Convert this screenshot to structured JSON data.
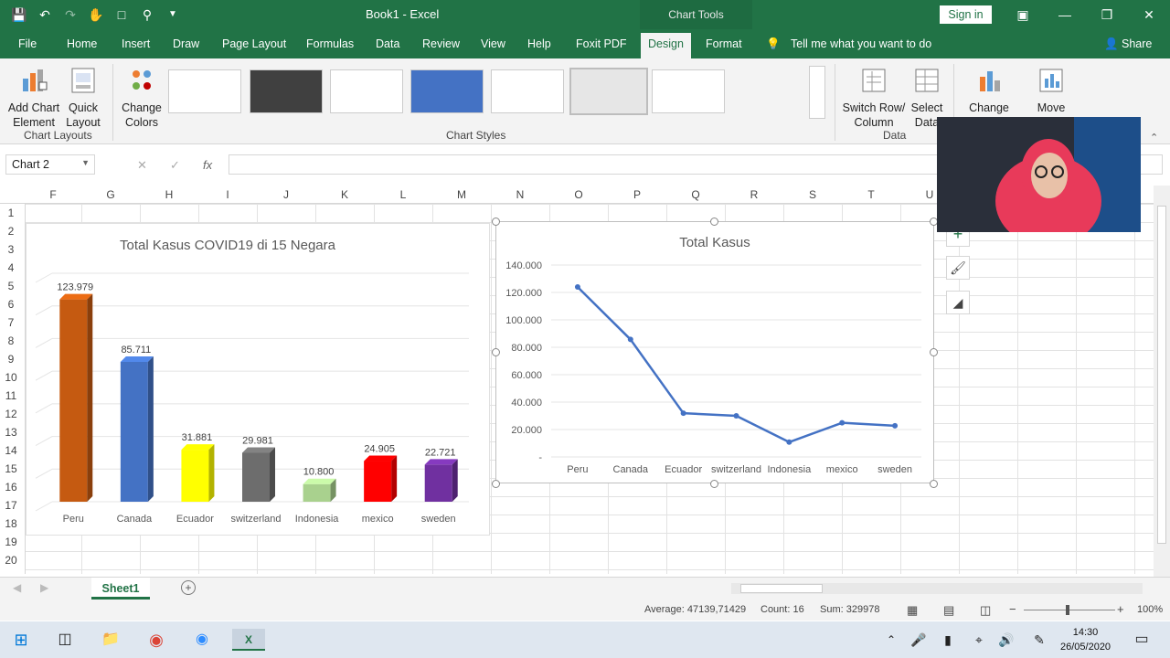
{
  "window": {
    "title": "Book1 - Excel",
    "context_tab": "Chart Tools",
    "signin": "Sign in"
  },
  "tabs": [
    "File",
    "Home",
    "Insert",
    "Draw",
    "Page Layout",
    "Formulas",
    "Data",
    "Review",
    "View",
    "Help",
    "Foxit PDF",
    "Design",
    "Format"
  ],
  "active_tab": "Design",
  "tell_me": "Tell me what you want to do",
  "share": "Share",
  "ribbon": {
    "add_chart_element": "Add Chart Element",
    "quick_layout": "Quick Layout",
    "change_colors": "Change Colors",
    "chart_layouts_label": "Chart Layouts",
    "chart_styles_label": "Chart Styles",
    "switch_row_column": "Switch Row/ Column",
    "select_data": "Select Data",
    "data_label": "Data",
    "change_chart_type": "Change Chart Type",
    "move_chart": "Move Chart"
  },
  "formula_bar": {
    "name_box": "Chart 2",
    "fx": "fx",
    "value": ""
  },
  "columns": [
    "F",
    "G",
    "H",
    "I",
    "J",
    "K",
    "L",
    "M",
    "N",
    "O",
    "P",
    "Q",
    "R",
    "S",
    "T",
    "U"
  ],
  "rows": [
    "1",
    "2",
    "3",
    "4",
    "5",
    "6",
    "7",
    "8",
    "9",
    "10",
    "11",
    "12",
    "13",
    "14",
    "15",
    "16",
    "17",
    "18",
    "19",
    "20"
  ],
  "chart_data": [
    {
      "type": "bar",
      "title": "Total Kasus COVID19 di 15 Negara",
      "categories": [
        "Peru",
        "Canada",
        "Ecuador",
        "switzerland",
        "Indonesia",
        "mexico",
        "sweden"
      ],
      "values": [
        123979,
        85711,
        31881,
        29981,
        10800,
        24905,
        22721
      ],
      "data_labels": [
        "123.979",
        "85.711",
        "31.881",
        "29.981",
        "10.800",
        "24.905",
        "22.721"
      ],
      "colors": [
        "#c55a11",
        "#4472c4",
        "#ffff00",
        "#6d6d6d",
        "#a9d18e",
        "#ff0000",
        "#7030a0"
      ],
      "ylim": [
        0,
        140000
      ],
      "grid": true
    },
    {
      "type": "line",
      "title": "Total Kasus",
      "categories": [
        "Peru",
        "Canada",
        "Ecuador",
        "switzerland",
        "Indonesia",
        "mexico",
        "sweden"
      ],
      "values": [
        123979,
        85711,
        31881,
        29981,
        10800,
        24905,
        22721
      ],
      "yticks": [
        "140.000",
        "120.000",
        "100.000",
        "80.000",
        "60.000",
        "40.000",
        "20.000",
        "-"
      ],
      "ylim": [
        0,
        140000
      ],
      "color": "#4472c4",
      "grid": true
    }
  ],
  "sheet": {
    "tab": "Sheet1"
  },
  "status": {
    "average": "Average: 47139,71429",
    "count": "Count: 16",
    "sum": "Sum: 329978",
    "zoom": "100%"
  },
  "taskbar": {
    "time": "14:30",
    "date": "26/05/2020"
  }
}
